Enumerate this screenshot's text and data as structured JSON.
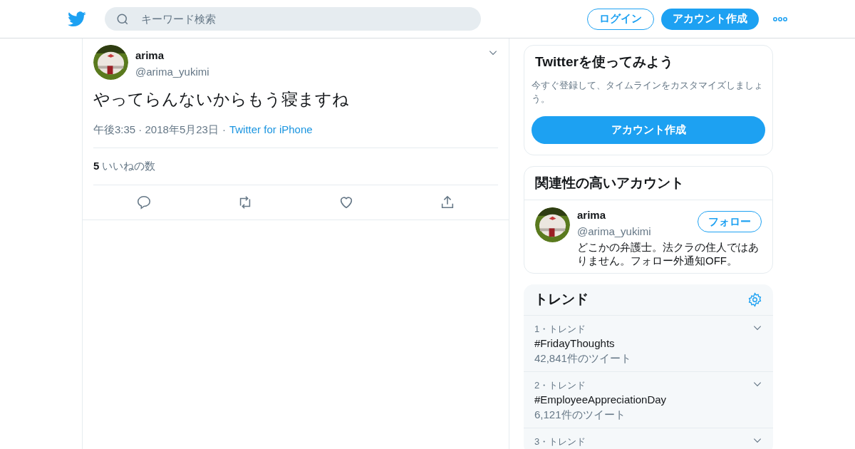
{
  "header": {
    "search": {
      "placeholder": "キーワード検索"
    },
    "login": "ログイン",
    "signup": "アカウント作成"
  },
  "tweet": {
    "name": "arima",
    "handle": "@arima_yukimi",
    "text": "やってらんないからもう寝ますね",
    "time": "午後3:35 · 2018年5月23日",
    "separator": "·",
    "source": "Twitter for iPhone",
    "likes_count": "5",
    "likes_label": "いいねの数"
  },
  "signup_card": {
    "title": "Twitterを使ってみよう",
    "body": "今すぐ登録して、タイムラインをカスタマイズしましょう。",
    "button": "アカウント作成"
  },
  "related": {
    "title": "関連性の高いアカウント",
    "accounts": [
      {
        "name": "arima",
        "handle": "@arima_yukimi",
        "follow": "フォロー",
        "bio": "どこかの弁護士。法クラの住人ではありません。フォロー外通知OFF。"
      }
    ]
  },
  "trends": {
    "title": "トレンド",
    "items": [
      {
        "rank": "1・トレンド",
        "name": "#FridayThoughts",
        "count": "42,841件のツイート"
      },
      {
        "rank": "2・トレンド",
        "name": "#EmployeeAppreciationDay",
        "count": "6,121件のツイート"
      },
      {
        "rank": "3・トレンド"
      }
    ]
  }
}
